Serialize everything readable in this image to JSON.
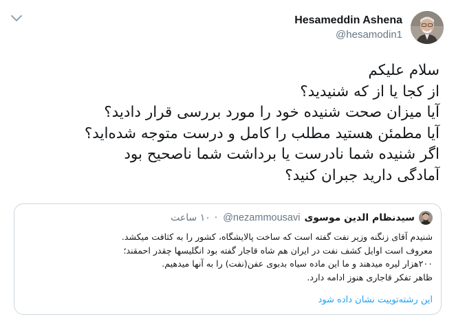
{
  "tweet": {
    "display_name": "Hesameddin Ashena",
    "handle": "@hesamodin1",
    "lines": [
      "سلام علیکم",
      "از کجا یا از که شنیدید؟",
      "آیا میزان صحت شنیده خود را مورد بررسی قرار دادید؟",
      "آیا مطمئن هستید مطلب را کامل و درست متوجه شده‌اید؟",
      "اگر شنیده شما نادرست یا برداشت شما ناصحیح بود",
      "آمادگی دارید جبران کنید؟"
    ]
  },
  "quoted": {
    "display_name": "سیدنظام الدین موسوی",
    "handle": "@nezammousavi",
    "time": "۱۰ ساعت",
    "separator": "·",
    "lines": [
      "شنیدم آقای زنگنه وزیر نفت گفته است که ساخت پالایشگاه، کشور را به کثافت میکشد.",
      "معروف است اوایل کشف نفت در ایران هم شاه قاجار گفته بود انگلیسها چقدر احمقند؛",
      "۲۰۰هزار لیره میدهند و ما این ماده سیاه بدبوی عفن(نفت) را به آنها میدهیم.",
      "ظاهر تفکر قاجاری هنوز ادامه دارد."
    ],
    "thread_link": "این رشته‌توییت نشان داده شود"
  },
  "colors": {
    "link": "#1da1f2",
    "secondary_text": "#657786",
    "border": "#ccd6dd"
  },
  "icons": {
    "menu": "chevron-down-icon"
  }
}
